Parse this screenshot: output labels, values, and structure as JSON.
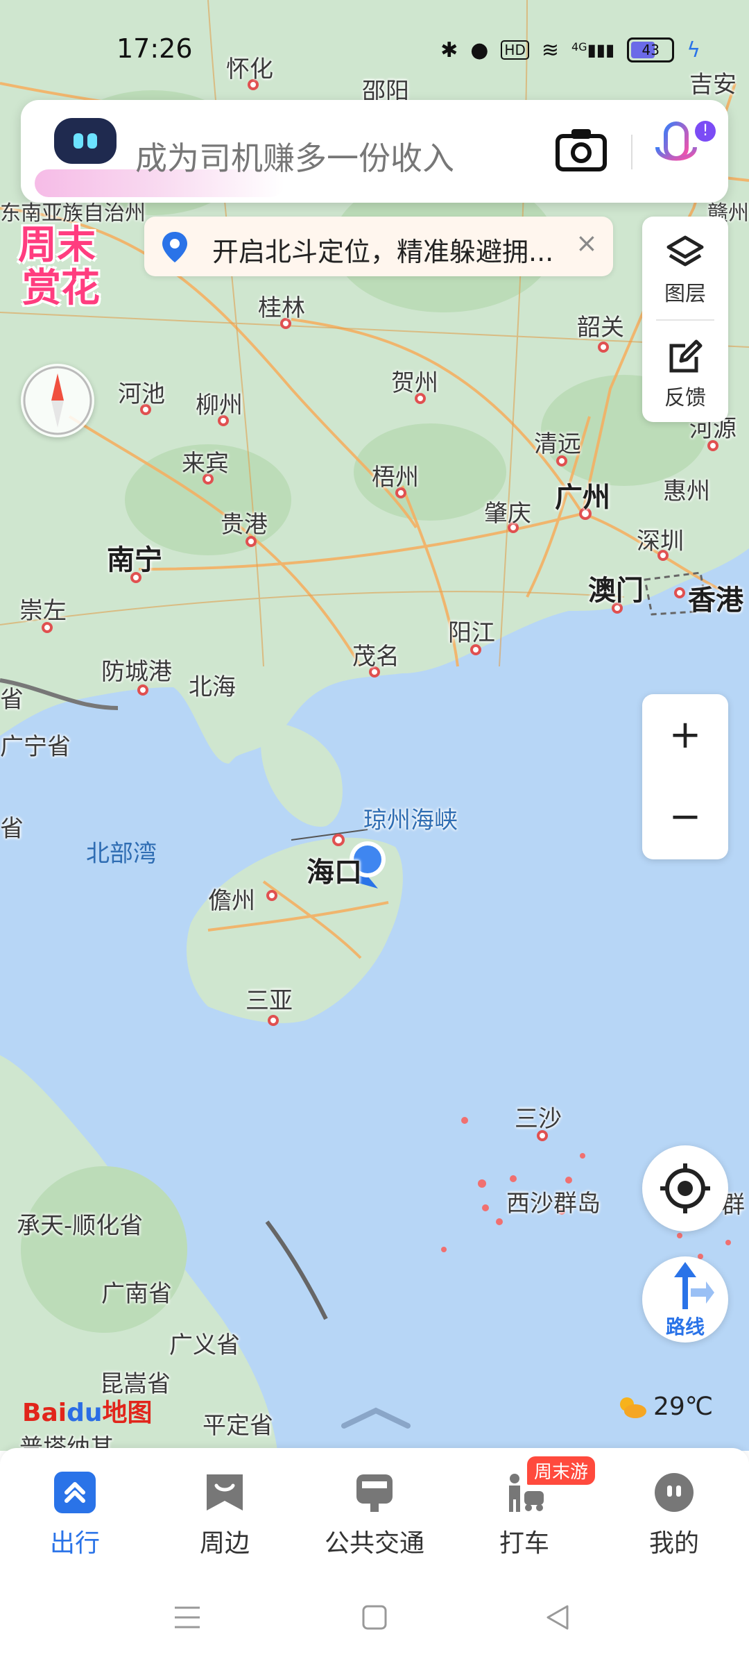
{
  "status_bar": {
    "time": "17:26",
    "battery": "43",
    "hd": "HD",
    "net": "4G"
  },
  "search": {
    "placeholder": "成为司机赚多一份收入"
  },
  "promo_badge": {
    "line1": "周末",
    "line2": "赏花"
  },
  "notice": {
    "text": "开启北斗定位，精准躲避拥...",
    "close": "×"
  },
  "right_panel": {
    "layers_label": "图层",
    "feedback_label": "反馈"
  },
  "zoom": {
    "in": "+",
    "out": "−"
  },
  "route": {
    "label": "路线"
  },
  "weather": {
    "temp": "29℃"
  },
  "logo": {
    "bai": "Bai",
    "du": "du",
    "map": "地图"
  },
  "map_labels": {
    "huaihua": "怀化",
    "shaoyang": "邵阳",
    "jian": "吉安",
    "guilin": "桂林",
    "shaoguan": "韶关",
    "hechi": "河池",
    "liuzhou": "柳州",
    "hezhou": "贺州",
    "qingyuan": "清远",
    "heyuan": "河源",
    "laibin": "来宾",
    "wuzhou": "梧州",
    "guangzhou": "广州",
    "huizhou": "惠州",
    "zhaoqing": "肇庆",
    "guigang": "贵港",
    "shenzhen": "深圳",
    "nanning": "南宁",
    "macau": "澳门",
    "hongkong": "香港",
    "chongzuo": "崇左",
    "yangjiang": "阳江",
    "maoming": "茂名",
    "fangchenggang": "防城港",
    "beihai": "北海",
    "guangning": "广宁省",
    "qiongzhou": "琼州海峡",
    "beibuwan": "北部湾",
    "haikou": "海口",
    "danzhou": "儋州",
    "sanya": "三亚",
    "sansha": "三沙",
    "xisha": "西沙群岛",
    "chengtian": "承天-顺化省",
    "guangnan": "广南省",
    "guangyi": "广义省",
    "kunsong": "昆嵩省",
    "pingding": "平定省",
    "dongnan": "东南亚族自治州",
    "sheng1": "省",
    "sheng2": "省",
    "qun": "群",
    "ganzhou": "赣州",
    "puta": "普塔纳其"
  },
  "tabs": [
    {
      "label": "出行"
    },
    {
      "label": "周边"
    },
    {
      "label": "公共交通"
    },
    {
      "label": "打车"
    },
    {
      "label": "我的"
    }
  ],
  "tab_tag": "周末游",
  "colors": {
    "accent": "#2a73e8",
    "land": "#cfe6cf",
    "water": "#b7d6f6",
    "road": "#f4b063",
    "promo": "#ff3d7f"
  }
}
